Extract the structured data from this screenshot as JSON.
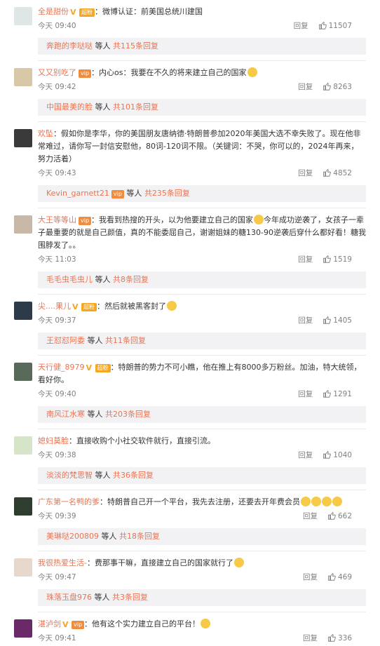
{
  "comments": [
    {
      "user": "全是甜份",
      "v": true,
      "badge": "超粉",
      "content": "：微博认证：前美国总统川建国",
      "time": "今天 09:40",
      "reply": "回复",
      "likes": "11507",
      "sub_user": "奔跑的李哒哒",
      "sub_mid": " 等人 ",
      "sub_count": "共115条回复",
      "avatar_color": "#dfe6e6"
    },
    {
      "user": "又又别吃了",
      "v": false,
      "vip": "vip",
      "content": "：内心os：我要在不久的将来建立自己的国家",
      "emoji": true,
      "time": "今天 09:42",
      "reply": "回复",
      "likes": "8263",
      "sub_user": "中国最美的脸",
      "sub_mid": " 等人 ",
      "sub_count": "共101条回复",
      "avatar_color": "#d9c7a8"
    },
    {
      "user": "欢坠",
      "content": "：假如你是李华，你的美国朋友唐纳德·特朗普参加2020年美国大选不幸失败了。现在他非常难过，请你写一封信安慰他，80词-120词不限。（关键词：不哭，你可以的，2024年再来，努力活着）",
      "time": "今天 09:43",
      "reply": "回复",
      "likes": "4852",
      "sub_user": "Kevin_garnett21",
      "sub_vip": "vip",
      "sub_mid": " 等人 ",
      "sub_count": "共235条回复",
      "avatar_color": "#3a3a3a"
    },
    {
      "user": "大王等等山",
      "vip": "vip",
      "content": "：我看到热搜的开头，以为他要建立自己的国家",
      "emoji": true,
      "content2": "今年成功逆袭了，女孩子一辈子最重要的就是自己颜值，真的不能委屈自己，谢谢姐妹的糖130-90逆袭后穿什么都好看！糖我围脖发了。。",
      "time": "今天 11:03",
      "reply": "回复",
      "likes": "1519",
      "sub_user": "毛毛虫毛虫儿",
      "sub_mid": " 等人 ",
      "sub_count": "共8条回复",
      "avatar_color": "#c9b8a6"
    },
    {
      "user": "尖....果儿",
      "v": true,
      "badge": "超粉",
      "content": "：然后就被黑客封了",
      "emoji": true,
      "time": "今天 09:37",
      "reply": "回复",
      "likes": "1405",
      "sub_user": "王怼怼阿委",
      "sub_mid": " 等人 ",
      "sub_count": "共11条回复",
      "avatar_color": "#2c3a4a"
    },
    {
      "user": "天行健_8979",
      "v": true,
      "badge": "超粉",
      "content": "：特朗普的势力不可小瞧，他在推上有8000多万粉丝。加油，特大统领，看好你。",
      "time": "今天 09:40",
      "reply": "回复",
      "likes": "1291",
      "sub_user": "南风江水寒",
      "sub_mid": " 等人 ",
      "sub_count": "共203条回复",
      "avatar_color": "#5a6a5a"
    },
    {
      "user": "媳妇莫脸",
      "content": "：直接收购个小社交软件就行，直接引流。",
      "time": "今天 09:38",
      "reply": "回复",
      "likes": "1040",
      "sub_user": "淡淡的梵思智",
      "sub_mid": " 等人 ",
      "sub_count": "共36条回复",
      "avatar_color": "#d6e4c8"
    },
    {
      "user": "广东第一名鸭的爹",
      "content": "：特朗普自己开一个平台，我先去注册，还要去开年费会员",
      "emoji4": true,
      "time": "今天 09:39",
      "reply": "回复",
      "likes": "662",
      "sub_user": "美琳哒200809",
      "sub_mid": " 等人 ",
      "sub_count": "共18条回复",
      "avatar_color": "#2f3d2f"
    },
    {
      "user": "我很热爱生活-",
      "content": "：费那事干嘛，直接建立自己的国家就行了",
      "emoji": true,
      "time": "今天 09:47",
      "reply": "回复",
      "likes": "469",
      "sub_user": "珠落玉盘976",
      "sub_mid": " 等人 ",
      "sub_count": "共3条回复",
      "avatar_color": "#e8d8cc"
    },
    {
      "user": "湛泸剑",
      "v": true,
      "vip": "vip",
      "content": "：他有这个实力建立自己的平台！",
      "emoji": true,
      "time": "今天 09:41",
      "reply": "回复",
      "likes": "336",
      "avatar_color": "#6a2a6a"
    }
  ]
}
